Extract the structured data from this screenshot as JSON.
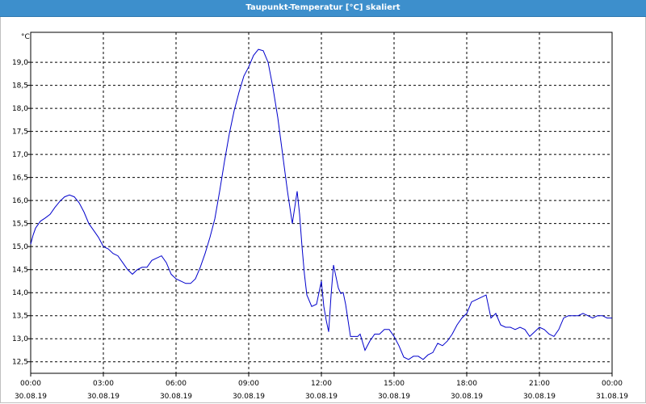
{
  "window": {
    "title": "Taupunkt-Temperatur [°C] skaliert"
  },
  "chart_data": {
    "type": "line",
    "title": "Taupunkt-Temperatur [°C] skaliert",
    "ylabel": "°C",
    "xlabel": "",
    "ylim": [
      12.25,
      19.65
    ],
    "y_ticks": [
      "19,0",
      "18,5",
      "18,0",
      "17,5",
      "17,0",
      "16,5",
      "16,0",
      "15,5",
      "15,0",
      "14,5",
      "14,0",
      "13,5",
      "13,0",
      "12,5"
    ],
    "x_ticks": [
      {
        "time": "00:00",
        "date": "30.08.19"
      },
      {
        "time": "03:00",
        "date": "30.08.19"
      },
      {
        "time": "06:00",
        "date": "30.08.19"
      },
      {
        "time": "09:00",
        "date": "30.08.19"
      },
      {
        "time": "12:00",
        "date": "30.08.19"
      },
      {
        "time": "15:00",
        "date": "30.08.19"
      },
      {
        "time": "18:00",
        "date": "30.08.19"
      },
      {
        "time": "21:00",
        "date": "30.08.19"
      },
      {
        "time": "00:00",
        "date": "31.08.19"
      }
    ],
    "grid": true,
    "line_color": "#0000cc",
    "series": [
      {
        "x_hours": [
          0,
          0.1,
          0.2,
          0.4,
          0.6,
          0.8,
          1.0,
          1.2,
          1.4,
          1.6,
          1.8,
          2.0,
          2.2,
          2.4,
          2.6,
          2.8,
          3.0,
          3.2,
          3.4,
          3.6,
          3.8,
          4.0,
          4.2,
          4.4,
          4.6,
          4.8,
          5.0,
          5.2,
          5.4,
          5.6,
          5.8,
          6.0,
          6.2,
          6.4,
          6.6,
          6.8,
          7.0,
          7.2,
          7.4,
          7.6,
          7.8,
          8.0,
          8.2,
          8.4,
          8.6,
          8.8,
          9.0,
          9.2,
          9.4,
          9.6,
          9.8,
          10.0,
          10.2,
          10.4,
          10.6,
          10.8,
          11.0,
          11.1,
          11.2,
          11.3,
          11.4,
          11.6,
          11.8,
          12.0,
          12.1,
          12.2,
          12.3,
          12.4,
          12.5,
          12.6,
          12.7,
          12.8,
          12.9,
          13.0,
          13.2,
          13.4,
          13.5,
          13.6,
          13.8,
          14.0,
          14.2,
          14.4,
          14.6,
          14.8,
          15.0,
          15.2,
          15.4,
          15.6,
          15.8,
          16.0,
          16.2,
          16.4,
          16.6,
          16.8,
          17.0,
          17.2,
          17.4,
          17.6,
          17.8,
          18.0,
          18.2,
          18.4,
          18.6,
          18.8,
          18.9,
          19.0,
          19.2,
          19.4,
          19.6,
          19.8,
          20.0,
          20.2,
          20.4,
          20.6,
          20.8,
          21.0,
          21.2,
          21.4,
          21.6,
          21.8,
          22.0,
          22.2,
          22.4,
          22.6,
          22.8,
          23.0,
          23.2,
          23.4,
          23.6,
          23.8,
          24.0
        ],
        "values": [
          15.05,
          15.25,
          15.4,
          15.55,
          15.62,
          15.7,
          15.85,
          15.98,
          16.08,
          16.12,
          16.08,
          15.95,
          15.75,
          15.5,
          15.35,
          15.2,
          15.0,
          14.95,
          14.85,
          14.8,
          14.65,
          14.5,
          14.4,
          14.5,
          14.55,
          14.55,
          14.7,
          14.75,
          14.8,
          14.65,
          14.4,
          14.3,
          14.25,
          14.2,
          14.2,
          14.3,
          14.55,
          14.85,
          15.2,
          15.6,
          16.2,
          16.85,
          17.45,
          17.95,
          18.35,
          18.7,
          18.9,
          19.15,
          19.28,
          19.25,
          19.0,
          18.45,
          17.8,
          17.0,
          16.2,
          15.5,
          16.2,
          15.7,
          15.0,
          14.4,
          13.95,
          13.7,
          13.75,
          14.25,
          13.7,
          13.4,
          13.15,
          13.95,
          14.6,
          14.35,
          14.1,
          13.98,
          14.0,
          13.75,
          13.05,
          13.05,
          13.05,
          13.1,
          12.75,
          12.95,
          13.1,
          13.1,
          13.2,
          13.2,
          13.05,
          12.85,
          12.6,
          12.55,
          12.62,
          12.62,
          12.55,
          12.65,
          12.7,
          12.9,
          12.85,
          12.95,
          13.1,
          13.3,
          13.45,
          13.55,
          13.8,
          13.85,
          13.9,
          13.95,
          13.7,
          13.45,
          13.55,
          13.3,
          13.25,
          13.25,
          13.2,
          13.25,
          13.2,
          13.05,
          13.15,
          13.25,
          13.2,
          13.1,
          13.05,
          13.2,
          13.45,
          13.5,
          13.5,
          13.5,
          13.55,
          13.5,
          13.45,
          13.5,
          13.5,
          13.45,
          13.45,
          13.45,
          13.5
        ]
      }
    ]
  }
}
